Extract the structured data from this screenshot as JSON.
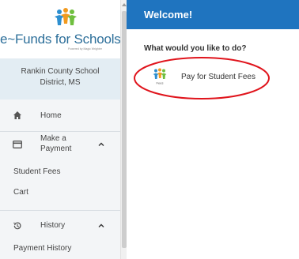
{
  "sidebar": {
    "logo": {
      "text": "e~Funds for Schools",
      "tagline": "Powered by Magic Wrighter"
    },
    "district": {
      "line1": "Rankin County School",
      "line2": "District, MS"
    },
    "nav": {
      "home": {
        "label": "Home",
        "icon": "home-icon"
      },
      "payment": {
        "line1": "Make a",
        "line2": "Payment",
        "icon": "credit-card-icon",
        "caret": "chevron-up-icon"
      },
      "payment_sub": [
        "Student Fees",
        "Cart"
      ],
      "history": {
        "label": "History",
        "icon": "history-icon",
        "caret": "chevron-up-icon"
      },
      "history_sub": [
        "Payment History"
      ]
    }
  },
  "main": {
    "header_title": "Welcome!",
    "question": "What would you like to do?",
    "actions": [
      {
        "label": "Pay for Student Fees",
        "icon_caption": "Fees",
        "icon": "fees-icon"
      }
    ]
  },
  "colors": {
    "header": "#1f74bf",
    "logo_text": "#2d6f9a",
    "annotation": "#e0141c",
    "sidebar_bg": "#f3f5f7",
    "district_bg": "#e3edf3"
  }
}
